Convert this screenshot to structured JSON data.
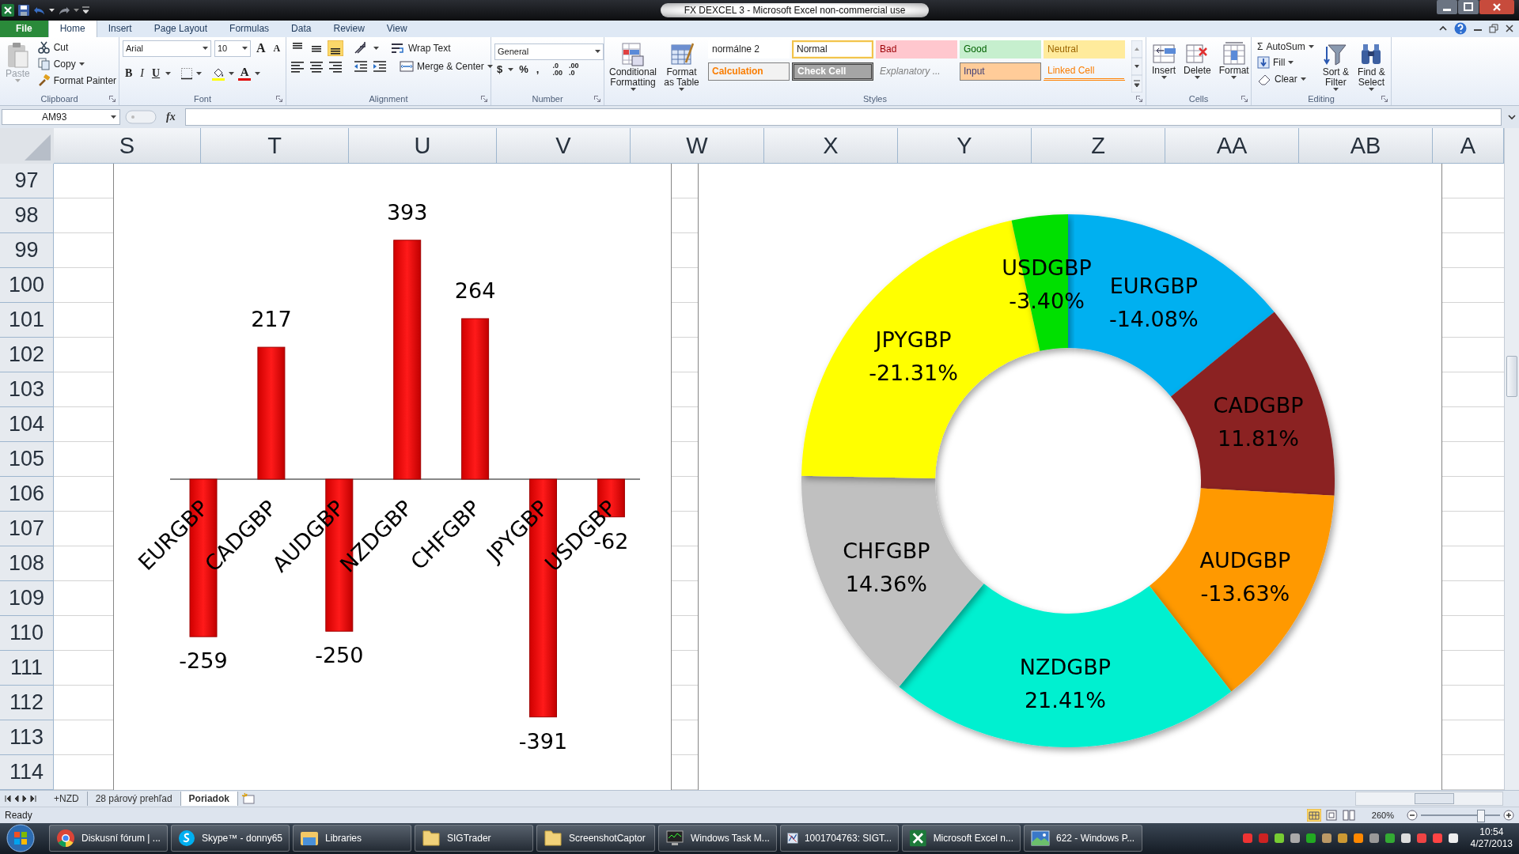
{
  "window": {
    "title": "FX DEXCEL 3  -  Microsoft Excel non-commercial use"
  },
  "ribbon_tabs": [
    {
      "label": "File",
      "kind": "file",
      "selected": false
    },
    {
      "label": "Home",
      "kind": "tab",
      "selected": true
    },
    {
      "label": "Insert",
      "kind": "tab",
      "selected": false
    },
    {
      "label": "Page Layout",
      "kind": "tab",
      "selected": false
    },
    {
      "label": "Formulas",
      "kind": "tab",
      "selected": false
    },
    {
      "label": "Data",
      "kind": "tab",
      "selected": false
    },
    {
      "label": "Review",
      "kind": "tab",
      "selected": false
    },
    {
      "label": "View",
      "kind": "tab",
      "selected": false
    }
  ],
  "clipboard": {
    "label": "Clipboard",
    "paste": {
      "label": "Paste",
      "disabled": true
    },
    "commands": [
      "Cut",
      "Copy",
      "Format Painter"
    ]
  },
  "font": {
    "label": "Font",
    "font_name": "Arial",
    "font_size": "10",
    "size_buttons": [
      "A",
      "A"
    ],
    "format_buttons": [
      "B",
      "I",
      "U"
    ],
    "font_color": "A"
  },
  "alignment": {
    "label": "Alignment",
    "commands": [
      "Wrap Text",
      "Merge & Center"
    ]
  },
  "number": {
    "label": "Number",
    "format": "General",
    "symbols": [
      "$",
      "%",
      ","
    ],
    "decimal_buttons": [
      [
        ".0",
        ".00"
      ],
      [
        ".00",
        ".0"
      ]
    ]
  },
  "styles": {
    "label": "Styles",
    "commands": [
      "Conditional Formatting",
      "Format as Table"
    ],
    "cell_styles": [
      {
        "label": "normálne 2",
        "kind": "plain",
        "selected": false
      },
      {
        "label": "Normal",
        "kind": "normal",
        "selected": true
      },
      {
        "label": "Bad",
        "kind": "bad",
        "selected": false
      },
      {
        "label": "Good",
        "kind": "good",
        "selected": false
      },
      {
        "label": "Neutral",
        "kind": "neutral",
        "selected": false
      },
      {
        "label": "Calculation",
        "kind": "calculation",
        "selected": false
      },
      {
        "label": "Check Cell",
        "kind": "check",
        "selected": false
      },
      {
        "label": "Explanatory ...",
        "kind": "explanatory",
        "selected": false
      },
      {
        "label": "Input",
        "kind": "input",
        "selected": false
      },
      {
        "label": "Linked Cell",
        "kind": "linked",
        "selected": false
      }
    ]
  },
  "cells": {
    "label": "Cells",
    "commands": [
      "Insert",
      "Delete",
      "Format"
    ]
  },
  "editing": {
    "label": "Editing",
    "sum_symbol": "Σ",
    "commands": [
      "AutoSum",
      "Fill",
      "Clear"
    ],
    "big_commands": [
      "Sort & Filter",
      "Find & Select"
    ]
  },
  "formula_bar": {
    "name_box": "AM93",
    "function_label": "fx"
  },
  "sheet": {
    "columns": [
      "S",
      "T",
      "U",
      "V",
      "W",
      "X",
      "Y",
      "Z",
      "AA",
      "AB",
      "A"
    ],
    "rows": [
      "97",
      "98",
      "99",
      "100",
      "101",
      "102",
      "103",
      "104",
      "105",
      "106",
      "107",
      "108",
      "109",
      "110",
      "111",
      "112",
      "113",
      "114"
    ]
  },
  "bar_chart": {
    "chart_data": {
      "type": "bar",
      "categories": [
        "EURGBP",
        "CADGBP",
        "AUDGBP",
        "NZDGBP",
        "CHFGBP",
        "JPYGBP",
        "USDGBP"
      ],
      "values": [
        -259,
        217,
        -250,
        393,
        264,
        -391,
        -62
      ],
      "data_labels": true
    }
  },
  "donut_chart": {
    "chart_data": {
      "type": "donut",
      "categories": [
        "EURGBP",
        "CADGBP",
        "AUDGBP",
        "NZDGBP",
        "CHFGBP",
        "JPYGBP",
        "USDGBP"
      ],
      "values": [
        14.08,
        11.81,
        13.63,
        21.41,
        14.36,
        21.31,
        3.4
      ],
      "colors": [
        "#00b0f0",
        "#8b2020",
        "#ff9900",
        "#00f0d0",
        "#c0c0c0",
        "#ffff00",
        "#00e000"
      ]
    },
    "percent_labels": [
      "-14.08%",
      "11.81%",
      "-13.63%",
      "21.41%",
      "14.36%",
      "-21.31%",
      "-3.40%"
    ]
  },
  "sheet_tabs": [
    {
      "label": "+NZD",
      "selected": false
    },
    {
      "label": "28 párový prehľad",
      "selected": false
    },
    {
      "label": "Poriadok",
      "selected": true
    }
  ],
  "status_bar": {
    "status": "Ready",
    "zoom": "260%",
    "zoom_slider": {
      "level": 0.75
    }
  },
  "taskbar": {
    "items": [
      {
        "label": "Diskusní fórum | ...",
        "kind": "browser"
      },
      {
        "label": "Skype™ - donny65",
        "kind": "chat"
      },
      {
        "label": "Libraries",
        "kind": "library"
      },
      {
        "label": "SIGTrader",
        "kind": "folder"
      },
      {
        "label": "ScreenshotCaptor",
        "kind": "folder"
      },
      {
        "label": "Windows Task M...",
        "kind": "monitor"
      },
      {
        "label": "1001704763: SIGT...",
        "kind": "chart"
      },
      {
        "label": "Microsoft Excel n...",
        "kind": "spreadsheet"
      },
      {
        "label": "622 - Windows P...",
        "kind": "photo"
      }
    ],
    "clock": {
      "time": "10:54",
      "date": "4/27/2013"
    }
  }
}
